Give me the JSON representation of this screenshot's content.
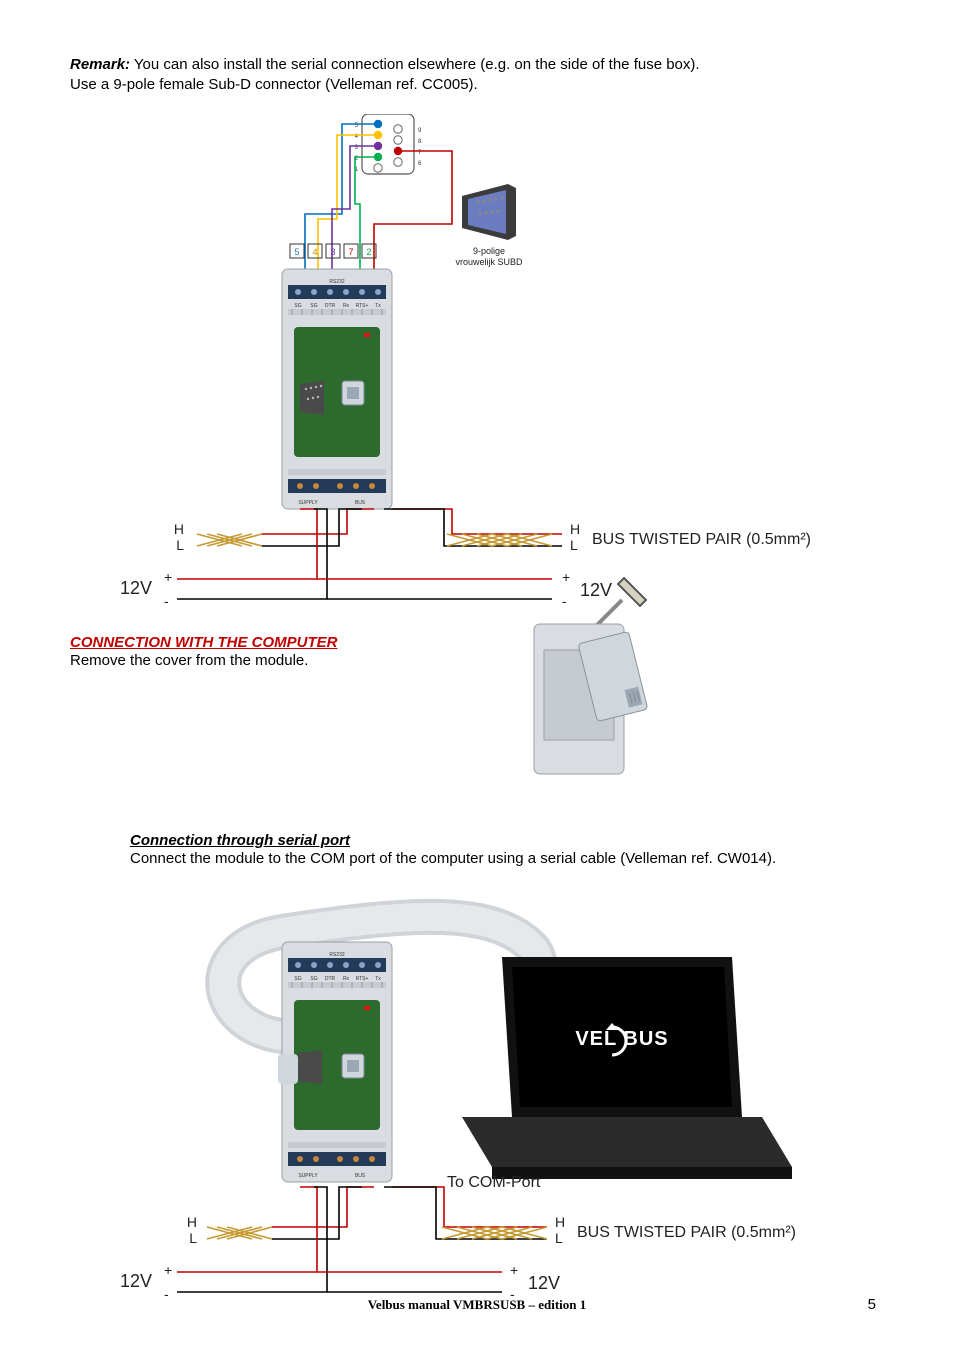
{
  "remark": {
    "label": "Remark:",
    "line1_rest": " You can also install the serial connection elsewhere (e.g. on the side of the fuse box).",
    "line2": "Use a 9-pole female Sub-D connector (Velleman ref. CC005)."
  },
  "fig1": {
    "subd_label_l1": "9-polige",
    "subd_label_l2": "vrouwelijk SUBD",
    "conn_pins": {
      "p5": "5",
      "p4": "4",
      "p3": "3",
      "p2": "2",
      "p1": "1",
      "p9": "9",
      "p8": "8",
      "p7": "7",
      "p6": "6"
    },
    "rs232": "RS232",
    "terms": {
      "sg1": "SG",
      "sg2": "SG",
      "dtr": "DTR",
      "rx": "Rx",
      "rts": "RTS+",
      "tx": "Tx"
    },
    "top_nums": {
      "n5": "5",
      "n4": "4",
      "n3": "3",
      "n7": "7",
      "n2": "2"
    },
    "bottom_terms": {
      "ps": "+",
      "mn": "-",
      "bl": "L",
      "bh": "H"
    },
    "bottom_groups": {
      "supply": "SUPPLY",
      "bus": "BUS"
    },
    "left_HL_H": "H",
    "left_HL_L": "L",
    "right_HL_H": "H",
    "right_HL_L": "L",
    "bus_label": "BUS TWISTED PAIR (0.5mm²)",
    "left_12v": "12V",
    "right_12v": "12V",
    "plus": "+",
    "minus": "-"
  },
  "section2": {
    "heading": "CONNECTION WITH THE COMPUTER",
    "body": "Remove the cover from the module."
  },
  "section3": {
    "heading": "Connection through serial port",
    "body": "Connect the module to the COM port of the computer using a serial cable (Velleman ref. CW014)."
  },
  "fig3": {
    "to_com": "To COM-Port",
    "velbus": "VEL BUS",
    "left_HL_H": "H",
    "left_HL_L": "L",
    "right_HL_H": "H",
    "right_HL_L": "L",
    "bus_label": "BUS TWISTED PAIR (0.5mm²)",
    "left_12v": "12V",
    "right_12v": "12V",
    "plus": "+",
    "minus": "-",
    "rs232": "RS232",
    "terms": {
      "sg1": "SG",
      "sg2": "SG",
      "dtr": "DTR",
      "rx": "Rx",
      "rts": "RTS+",
      "tx": "Tx"
    },
    "bottom_groups": {
      "supply": "SUPPLY",
      "bus": "BUS"
    }
  },
  "footer": "Velbus manual VMBRSUSB – edition 1",
  "page_number": "5"
}
